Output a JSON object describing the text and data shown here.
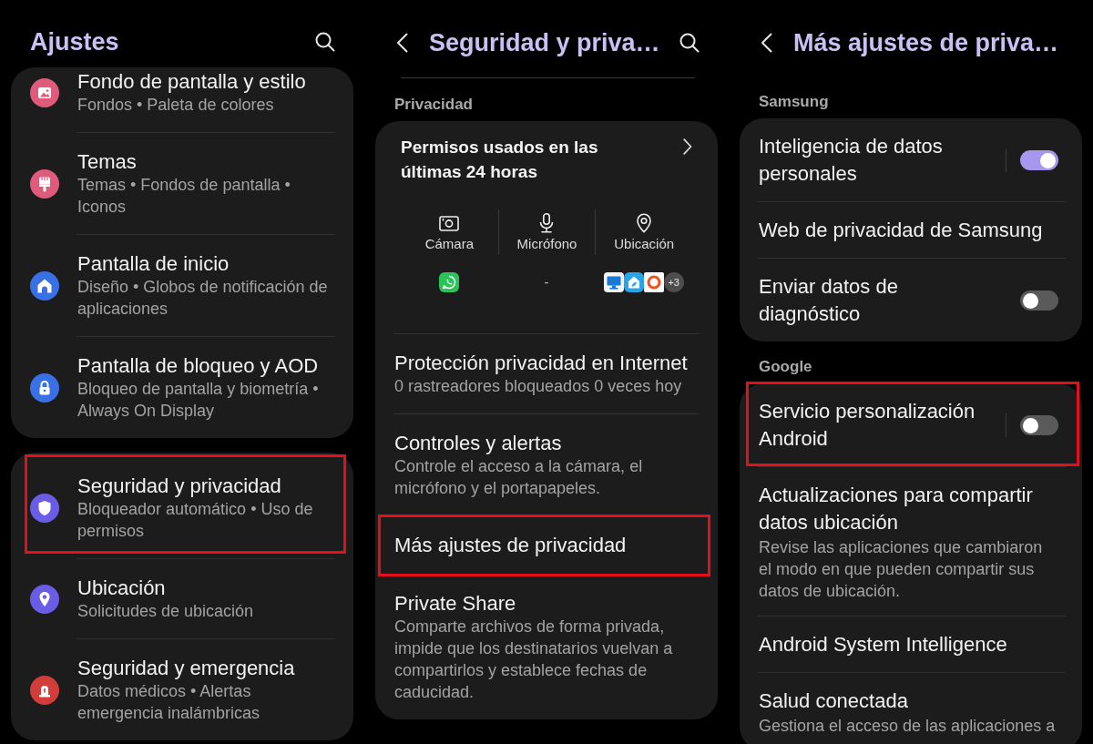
{
  "settings": {
    "title": "Ajustes",
    "cards": [
      {
        "items": [
          {
            "title": "Fondo de pantalla y estilo",
            "subtitle": "Fondos • Paleta de colores",
            "color": "#e05a7c",
            "highlighted": false
          },
          {
            "title": "Temas",
            "subtitle": "Temas • Fondos de pantalla • Iconos",
            "color": "#e05a7c",
            "highlighted": false
          },
          {
            "title": "Pantalla de inicio",
            "subtitle": "Diseño • Globos de notificación de aplicaciones",
            "color": "#3a70e6",
            "highlighted": false
          },
          {
            "title": "Pantalla de bloqueo y AOD",
            "subtitle": "Bloqueo de pantalla y biometría • Always On Display",
            "color": "#3a70e6",
            "highlighted": false
          }
        ]
      },
      {
        "items": [
          {
            "title": "Seguridad y privacidad",
            "subtitle": "Bloqueador automático • Uso de permisos",
            "color": "#6b5ce6",
            "highlighted": true
          },
          {
            "title": "Ubicación",
            "subtitle": "Solicitudes de ubicación",
            "color": "#6b5ce6",
            "highlighted": false
          },
          {
            "title": "Seguridad y emergencia",
            "subtitle": "Datos médicos • Alertas emergencia inalámbricas",
            "color": "#d23c3a",
            "highlighted": false
          }
        ]
      }
    ]
  },
  "security_privacy": {
    "title": "Seguridad y priva…",
    "section": "Privacidad",
    "recent_permissions": {
      "title": "Permisos usados en las últimas 24 horas",
      "columns": [
        {
          "label": "Cámara",
          "kind": "apps"
        },
        {
          "label": "Micrófono",
          "kind": "none",
          "text": "-"
        },
        {
          "label": "Ubicación",
          "kind": "apps",
          "more": "+3"
        }
      ]
    },
    "items": [
      {
        "title": "Protección privacidad en Internet",
        "subtitle": "0 rastreadores bloqueados 0 veces hoy",
        "highlighted": false
      },
      {
        "title": "Controles y alertas",
        "subtitle": "Controle el acceso a la cámara, el micrófono y el portapapeles.",
        "highlighted": false
      },
      {
        "title": "Más ajustes de privacidad",
        "highlighted": true
      },
      {
        "title": "Private Share",
        "subtitle": "Comparte archivos de forma privada, impide que los destinatarios vuelvan a compartirlos y establece fechas de caducidad.",
        "highlighted": false
      }
    ]
  },
  "more_privacy": {
    "title": "Más ajustes de priva…",
    "sections": [
      {
        "title": "Samsung",
        "items": [
          {
            "kind": "split_switch",
            "title": "Inteligencia de datos personales",
            "on": true,
            "highlighted": false
          },
          {
            "kind": "link",
            "title": "Web de privacidad de Samsung",
            "highlighted": false
          },
          {
            "kind": "switch",
            "title": "Enviar datos de diagnóstico",
            "on": false,
            "highlighted": false
          }
        ]
      },
      {
        "title": "Google",
        "items": [
          {
            "kind": "split_switch",
            "title": "Servicio personalización Android",
            "on": false,
            "highlighted": true
          },
          {
            "kind": "link",
            "title": "Actualizaciones para compartir datos ubicación",
            "subtitle": "Revise las aplicaciones que cambiaron el modo en que pueden compartir sus datos de ubicación.",
            "highlighted": false
          },
          {
            "kind": "link",
            "title": "Android System Intelligence",
            "highlighted": false
          },
          {
            "kind": "link",
            "title": "Salud conectada",
            "subtitle": "Gestiona el acceso de las aplicaciones a",
            "highlighted": false
          }
        ]
      }
    ]
  }
}
